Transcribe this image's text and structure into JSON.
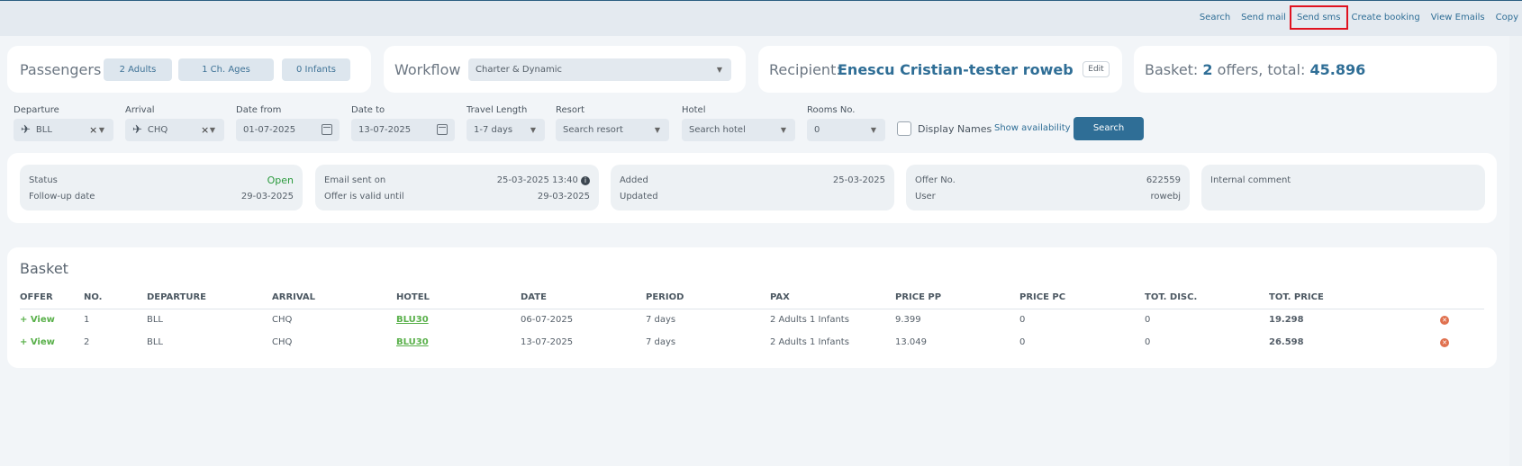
{
  "toplinks": [
    "Search",
    "Send mail",
    "Send sms",
    "Create booking",
    "View Emails",
    "Copy"
  ],
  "passengers": {
    "title": "Passengers",
    "adults": "2 Adults",
    "children": "1 Ch. Ages",
    "infants": "0 Infants"
  },
  "workflow": {
    "title": "Workflow",
    "value": "Charter & Dynamic"
  },
  "recipient": {
    "label": "Recipient:",
    "name": "Enescu Cristian-tester roweb",
    "edit": "Edit"
  },
  "basket_summary": {
    "label": "Basket:",
    "count": "2",
    "mid": "offers, total:",
    "total": "45.896"
  },
  "filters": {
    "departure_label": "Departure",
    "departure_value": "BLL",
    "arrival_label": "Arrival",
    "arrival_value": "CHQ",
    "date_from_label": "Date from",
    "date_from_value": "01-07-2025",
    "date_to_label": "Date to",
    "date_to_value": "13-07-2025",
    "travel_length_label": "Travel Length",
    "travel_length_value": "1-7 days",
    "resort_label": "Resort",
    "resort_placeholder": "Search resort",
    "hotel_label": "Hotel",
    "hotel_placeholder": "Search hotel",
    "rooms_label": "Rooms No.",
    "rooms_value": "0",
    "display_names": "Display Names",
    "show_availability": "Show availability",
    "search": "Search"
  },
  "info": {
    "status_k": "Status",
    "status_v": "Open",
    "followup_k": "Follow-up date",
    "followup_v": "29-03-2025",
    "email_k": "Email sent on",
    "email_v": "25-03-2025 13:40",
    "valid_k": "Offer is valid until",
    "valid_v": "29-03-2025",
    "added_k": "Added",
    "added_v": "25-03-2025",
    "updated_k": "Updated",
    "offer_k": "Offer No.",
    "offer_v": "622559",
    "user_k": "User",
    "user_v": "rowebj",
    "comment_k": "Internal comment"
  },
  "basket": {
    "title": "Basket",
    "headers": [
      "OFFER",
      "NO.",
      "DEPARTURE",
      "ARRIVAL",
      "HOTEL",
      "DATE",
      "PERIOD",
      "PAX",
      "PRICE PP",
      "PRICE PC",
      "TOT. DISC.",
      "TOT. PRICE"
    ],
    "rows": [
      {
        "view": "+ View",
        "no": "1",
        "dep": "BLL",
        "arr": "CHQ",
        "hotel": "BLU30",
        "date": "06-07-2025",
        "period": "7 days",
        "pax": "2 Adults 1 Infants",
        "pp": "9.399",
        "pc": "0",
        "disc": "0",
        "total": "19.298"
      },
      {
        "view": "+ View",
        "no": "2",
        "dep": "BLL",
        "arr": "CHQ",
        "hotel": "BLU30",
        "date": "13-07-2025",
        "period": "7 days",
        "pax": "2 Adults 1 Infants",
        "pp": "13.049",
        "pc": "0",
        "disc": "0",
        "total": "26.598"
      }
    ]
  },
  "colors": {
    "accent": "#2f6e96",
    "status_open": "#2a9a3c",
    "link_green": "#59b04a",
    "highlight": "#e0121f"
  }
}
